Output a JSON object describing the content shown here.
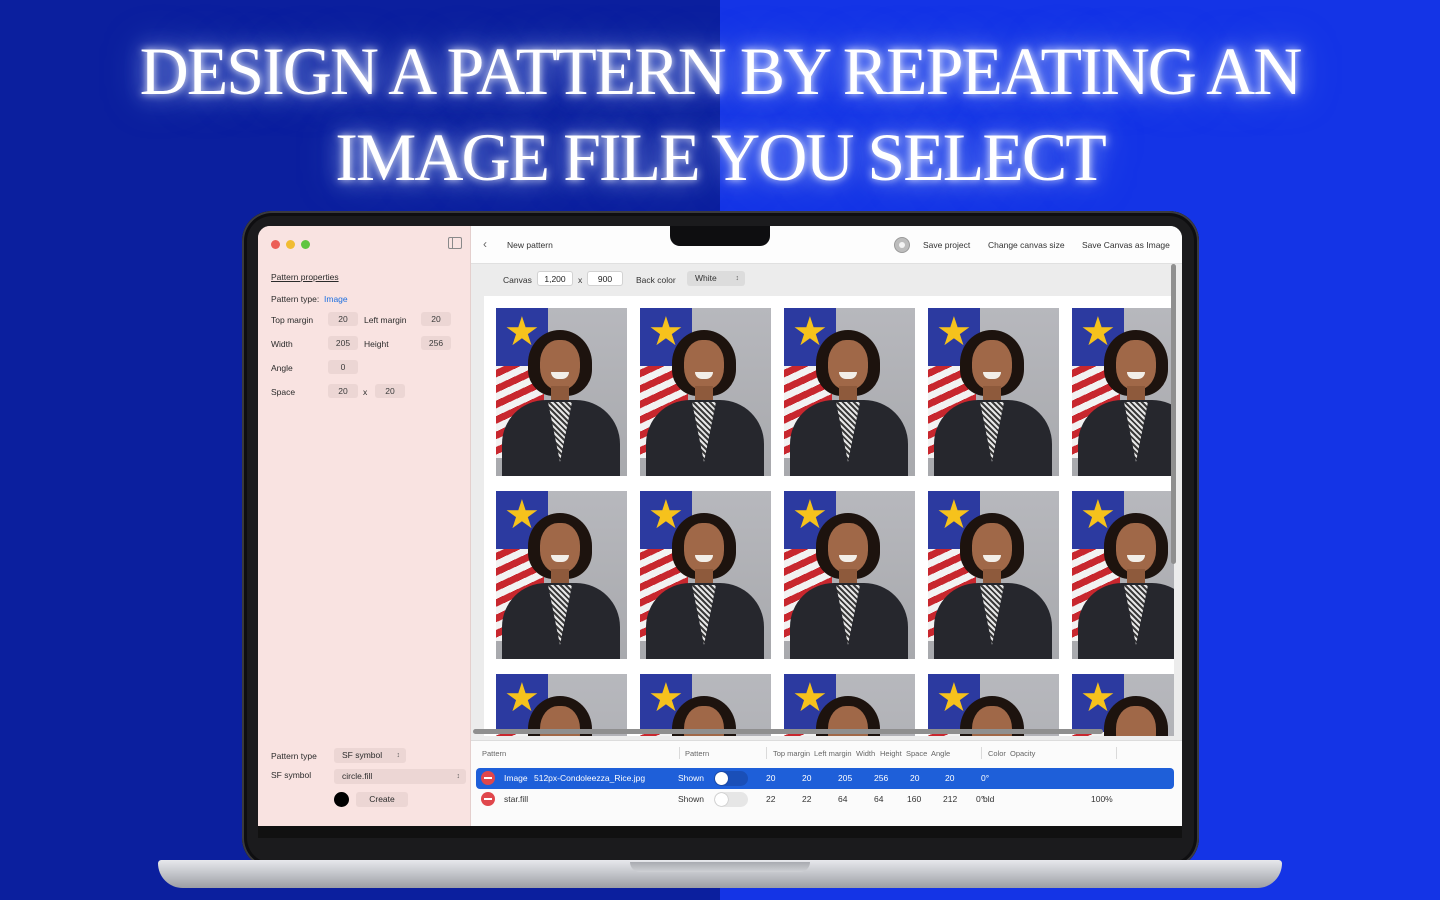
{
  "headline": {
    "line1": "DESIGN A PATTERN BY REPEATING AN",
    "line2": "IMAGE FILE YOU SELECT"
  },
  "colors": {
    "background_left": "#0b1f9e",
    "background_right": "#1434e6",
    "sidebar": "#f9e3e1",
    "selection": "#1e5fd9",
    "link": "#1d6fe0"
  },
  "app": {
    "header": {
      "back_icon": "chevron-left-icon",
      "title": "New pattern",
      "settings_icon": "gear-icon",
      "save_project": "Save project",
      "change_canvas_size": "Change canvas size",
      "save_canvas_as_image": "Save Canvas as Image"
    },
    "toolbar": {
      "canvas_label": "Canvas",
      "canvas_width": "1,200",
      "x_sep": "x",
      "canvas_height": "900",
      "back_color_label": "Back color",
      "back_color_value": "White"
    },
    "sidebar": {
      "section_title": "Pattern properties",
      "pattern_type_label": "Pattern type:",
      "pattern_type_value": "Image",
      "top_margin_label": "Top margin",
      "top_margin_value": "20",
      "left_margin_label": "Left margin",
      "left_margin_value": "20",
      "width_label": "Width",
      "width_value": "205",
      "height_label": "Height",
      "height_value": "256",
      "angle_label": "Angle",
      "angle_value": "0",
      "space_label": "Space",
      "space_x_value": "20",
      "space_sep": "x",
      "space_y_value": "20",
      "new_pattern_type_label": "Pattern type",
      "new_pattern_type_value": "SF symbol",
      "sf_symbol_label": "SF symbol",
      "sf_symbol_value": "circle.fill",
      "create_button": "Create"
    },
    "canvas": {
      "rows": 3,
      "cols": 5
    },
    "table": {
      "headers": [
        "Pattern",
        "Pattern",
        "Top margin",
        "Left margin",
        "Width",
        "Height",
        "Space",
        "Angle",
        "Color",
        "Opacity"
      ],
      "rows": [
        {
          "type": "Image",
          "name": "512px-Condoleezza_Rice.jpg",
          "visibility": "Shown",
          "top_margin": "20",
          "left_margin": "20",
          "width": "205",
          "height": "256",
          "space_x": "20",
          "space_y": "20",
          "angle": "0°",
          "color": "",
          "opacity": ""
        },
        {
          "type": "",
          "name": "star.fill",
          "visibility": "Shown",
          "top_margin": "22",
          "left_margin": "22",
          "width": "64",
          "height": "64",
          "space_x": "160",
          "space_y": "212",
          "angle": "0°",
          "color": "bld",
          "opacity": "100%"
        }
      ]
    }
  }
}
